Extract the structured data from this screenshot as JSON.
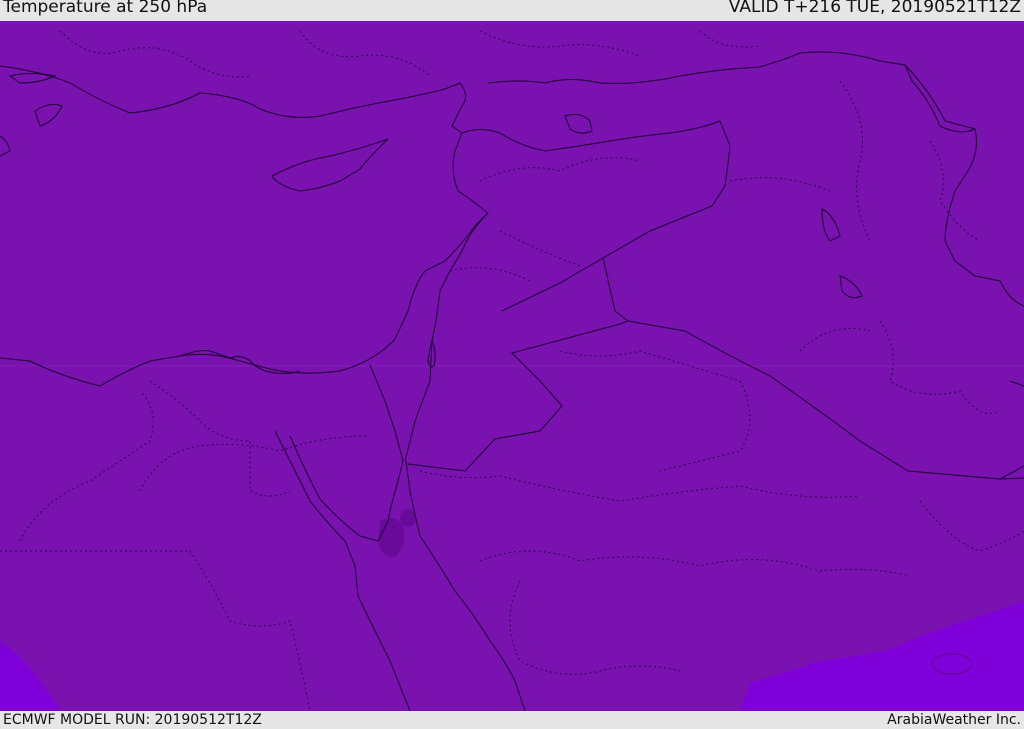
{
  "header": {
    "title": "Temperature at 250 hPa",
    "valid": "VALID T+216 TUE, 20190521T12Z"
  },
  "footer": {
    "model_run": "ECMWF MODEL RUN: 20190512T12Z",
    "credit": "ArabiaWeather Inc."
  },
  "colors": {
    "background_field": "#7a12b0",
    "warm_patch": "#6a0a9a",
    "cool_region": "#7f00d8",
    "coastline": "#1a0030",
    "border": "#1a0030",
    "province_border": "#2a0050",
    "bar_bg": "#e6e6e6"
  }
}
